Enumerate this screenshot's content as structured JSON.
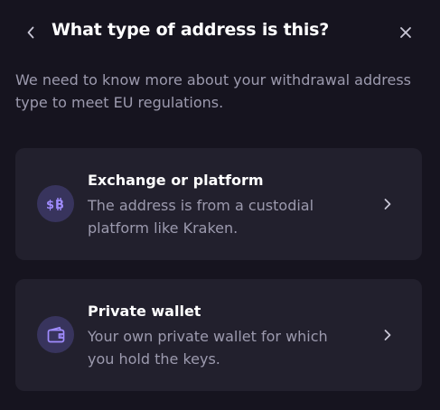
{
  "header": {
    "title": "What type of address is this?",
    "back_icon": "chevron-left-icon",
    "close_icon": "close-icon"
  },
  "description": "We need to know more about your withdrawal address type to meet EU regulations.",
  "options": [
    {
      "title": "Exchange or platform",
      "description": "The address is from a custodial platform like Kraken.",
      "icon": "exchange-currency-icon"
    },
    {
      "title": "Private wallet",
      "description": "Your own private wallet for which you hold the keys.",
      "icon": "wallet-icon"
    }
  ],
  "colors": {
    "background": "#16141f",
    "card": "#22202d",
    "icon_circle": "#38345d",
    "icon_accent": "#a08cff",
    "muted_text": "#9c9aae",
    "chevron": "#c9c7d6"
  }
}
